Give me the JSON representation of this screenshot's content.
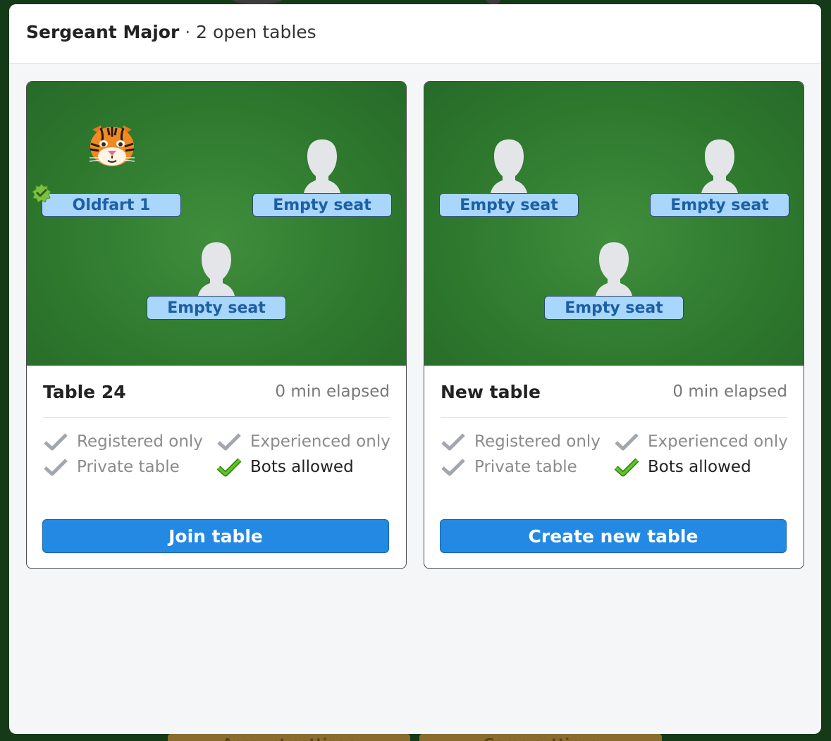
{
  "background": {
    "account_settings_label": "Account settings",
    "game_settings_label": "Game settings"
  },
  "header": {
    "title": "Sergeant Major",
    "separator": " · ",
    "open_tables": "2 open tables"
  },
  "tables": [
    {
      "name": "Table 24",
      "elapsed": "0 min elapsed",
      "seats": [
        {
          "label": "Oldfart 1",
          "avatar": "tiger-icon",
          "verified": true
        },
        {
          "label": "Empty seat",
          "avatar": "person-silhouette-icon"
        },
        {
          "label": "Empty seat",
          "avatar": "person-silhouette-icon"
        }
      ],
      "options": [
        {
          "label": "Registered only",
          "checked": false
        },
        {
          "label": "Experienced only",
          "checked": false
        },
        {
          "label": "Private table",
          "checked": false
        },
        {
          "label": "Bots allowed",
          "checked": true
        }
      ],
      "button_label": "Join table"
    },
    {
      "name": "New table",
      "elapsed": "0 min elapsed",
      "seats": [
        {
          "label": "Empty seat",
          "avatar": "person-silhouette-icon"
        },
        {
          "label": "Empty seat",
          "avatar": "person-silhouette-icon"
        },
        {
          "label": "Empty seat",
          "avatar": "person-silhouette-icon"
        }
      ],
      "options": [
        {
          "label": "Registered only",
          "checked": false
        },
        {
          "label": "Experienced only",
          "checked": false
        },
        {
          "label": "Private table",
          "checked": false
        },
        {
          "label": "Bots allowed",
          "checked": true
        }
      ],
      "button_label": "Create new table"
    }
  ],
  "colors": {
    "felt": "#2f7a2f",
    "nameplate_bg": "#a9d6fb",
    "nameplate_text": "#1c5fa3",
    "button_bg": "#2389e3",
    "check_on": "#4cb81c",
    "check_off": "#9aa0a6"
  }
}
